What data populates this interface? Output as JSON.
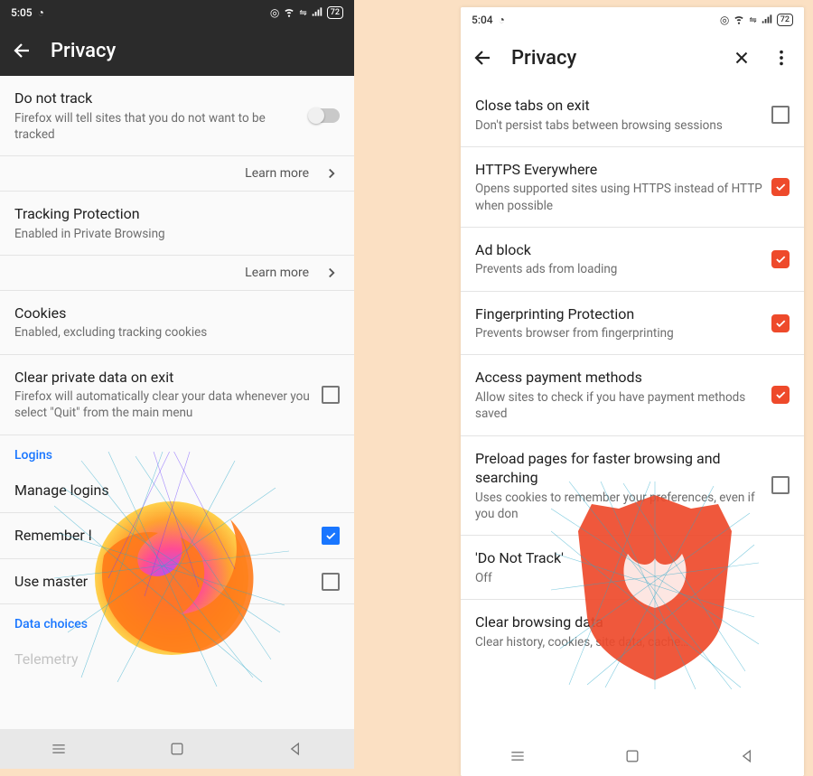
{
  "left": {
    "status": {
      "time": "5:05",
      "battery": "72"
    },
    "header": {
      "title": "Privacy"
    },
    "rows": {
      "dnt": {
        "title": "Do not track",
        "sub": "Firefox will tell sites that you do not want to be tracked"
      },
      "learn1": {
        "label": "Learn more"
      },
      "tracking": {
        "title": "Tracking Protection",
        "sub": "Enabled in Private Browsing"
      },
      "learn2": {
        "label": "Learn more"
      },
      "cookies": {
        "title": "Cookies",
        "sub": "Enabled, excluding tracking cookies"
      },
      "clear_exit": {
        "title": "Clear private data on exit",
        "sub": "Firefox will automatically clear your data whenever you select \"Quit\" from the main menu"
      },
      "section_logins": {
        "label": "Logins"
      },
      "manage_logins": {
        "title": "Manage logins"
      },
      "remember": {
        "title": "Remember l"
      },
      "master": {
        "title": "Use master"
      },
      "section_data": {
        "label": "Data choices"
      },
      "telemetry": {
        "title": "Telemetry"
      }
    }
  },
  "right": {
    "status": {
      "time": "5:04",
      "battery": "72"
    },
    "header": {
      "title": "Privacy"
    },
    "rows": {
      "close_tabs": {
        "title": "Close tabs on exit",
        "sub": "Don't persist tabs between browsing sessions"
      },
      "https": {
        "title": "HTTPS Everywhere",
        "sub": "Opens supported sites using HTTPS instead of HTTP when possible"
      },
      "adblock": {
        "title": "Ad block",
        "sub": "Prevents ads from loading"
      },
      "fingerprint": {
        "title": "Fingerprinting Protection",
        "sub": "Prevents browser from fingerprinting"
      },
      "payment": {
        "title": "Access payment methods",
        "sub": "Allow sites to check if you have payment methods saved"
      },
      "preload": {
        "title": "Preload pages for faster browsing and searching",
        "sub": "Uses cookies to remember your preferences, even if you don"
      },
      "dnt": {
        "title": "'Do Not Track'",
        "sub": "Off"
      },
      "clear": {
        "title": "Clear browsing data",
        "sub": "Clear history, cookies, site data, cache…"
      }
    }
  }
}
